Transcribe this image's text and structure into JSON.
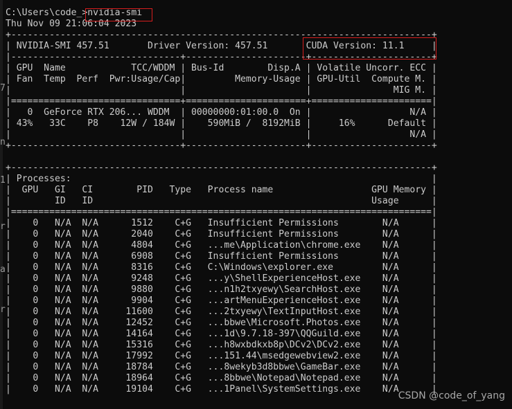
{
  "terminal": {
    "prompt_path": "C:\\Users\\code_",
    "prompt_symbol": ">",
    "command": "nvidia-smi",
    "timestamp": "Thu Nov 09 21:06:04 2023"
  },
  "smi": {
    "border_top": "+-----------------------------------------------------------------------------+",
    "header_line": "| NVIDIA-SMI 457.51       Driver Version: 457.51       CUDA Version: 11.1     |",
    "sep_dash": "|-------------------------------+----------------------+----------------------+",
    "col_head_1": "| GPU  Name            TCC/WDDM | Bus-Id        Disp.A | Volatile Uncorr. ECC |",
    "col_head_2": "| Fan  Temp  Perf  Pwr:Usage/Cap|         Memory-Usage | GPU-Util  Compute M. |",
    "col_head_3": "|                               |                      |               MIG M. |",
    "sep_eq": "|===============================+======================+======================|",
    "gpu_row_1": "|   0  GeForce RTX 206... WDDM  | 00000000:01:00.0  On |                  N/A |",
    "gpu_row_2": "| 43%   33C    P8    12W / 184W |    590MiB /  8192MiB |     16%      Default |",
    "gpu_row_3": "|                               |                      |                  N/A |",
    "border_bottom": "+-------------------------------+----------------------+----------------------+",
    "blank": "",
    "proc_border_top": "+-----------------------------------------------------------------------------+",
    "proc_title": "| Processes:                                                                  |",
    "proc_head_1": "|  GPU   GI   CI        PID   Type   Process name                  GPU Memory |",
    "proc_head_2": "|        ID   ID                                                   Usage      |",
    "proc_sep_eq": "|=============================================================================|",
    "processes": [
      "|    0   N/A  N/A      1512    C+G   Insufficient Permissions        N/A      |",
      "|    0   N/A  N/A      2040    C+G   Insufficient Permissions        N/A      |",
      "|    0   N/A  N/A      4804    C+G   ...me\\Application\\chrome.exe    N/A      |",
      "|    0   N/A  N/A      6908    C+G   Insufficient Permissions        N/A      |",
      "|    0   N/A  N/A      8316    C+G   C:\\Windows\\explorer.exe         N/A      |",
      "|    0   N/A  N/A      9248    C+G   ...y\\ShellExperienceHost.exe    N/A      |",
      "|    0   N/A  N/A      9880    C+G   ...n1h2txyewy\\SearchHost.exe    N/A      |",
      "|    0   N/A  N/A      9904    C+G   ...artMenuExperienceHost.exe    N/A      |",
      "|    0   N/A  N/A     11600    C+G   ...2txyewy\\TextInputHost.exe    N/A      |",
      "|    0   N/A  N/A     12452    C+G   ...bbwe\\Microsoft.Photos.exe    N/A      |",
      "|    0   N/A  N/A     14164    C+G   ...1d\\9.7.18-397\\QQGuild.exe    N/A      |",
      "|    0   N/A  N/A     15316    C+G   ...h8wxbdkxb8p\\DCv2\\DCv2.exe    N/A      |",
      "|    0   N/A  N/A     17992    C+G   ...151.44\\msedgewebview2.exe    N/A      |",
      "|    0   N/A  N/A     18784    C+G   ...8wekyb3d8bbwe\\GameBar.exe    N/A      |",
      "|    0   N/A  N/A     18964    C+G   ...8bbwe\\Notepad\\Notepad.exe    N/A      |",
      "|    0   N/A  N/A     19104    C+G   ...1Panel\\SystemSettings.exe    N/A      |"
    ]
  },
  "gutter": {
    "marks": [
      "7",
      "n",
      "1",
      "r",
      "a",
      "r"
    ]
  },
  "watermark": "CSDN @code_of_yang",
  "colors": {
    "background": "#0c0c0c",
    "text": "#cccccc",
    "highlight": "#d81e1e"
  }
}
